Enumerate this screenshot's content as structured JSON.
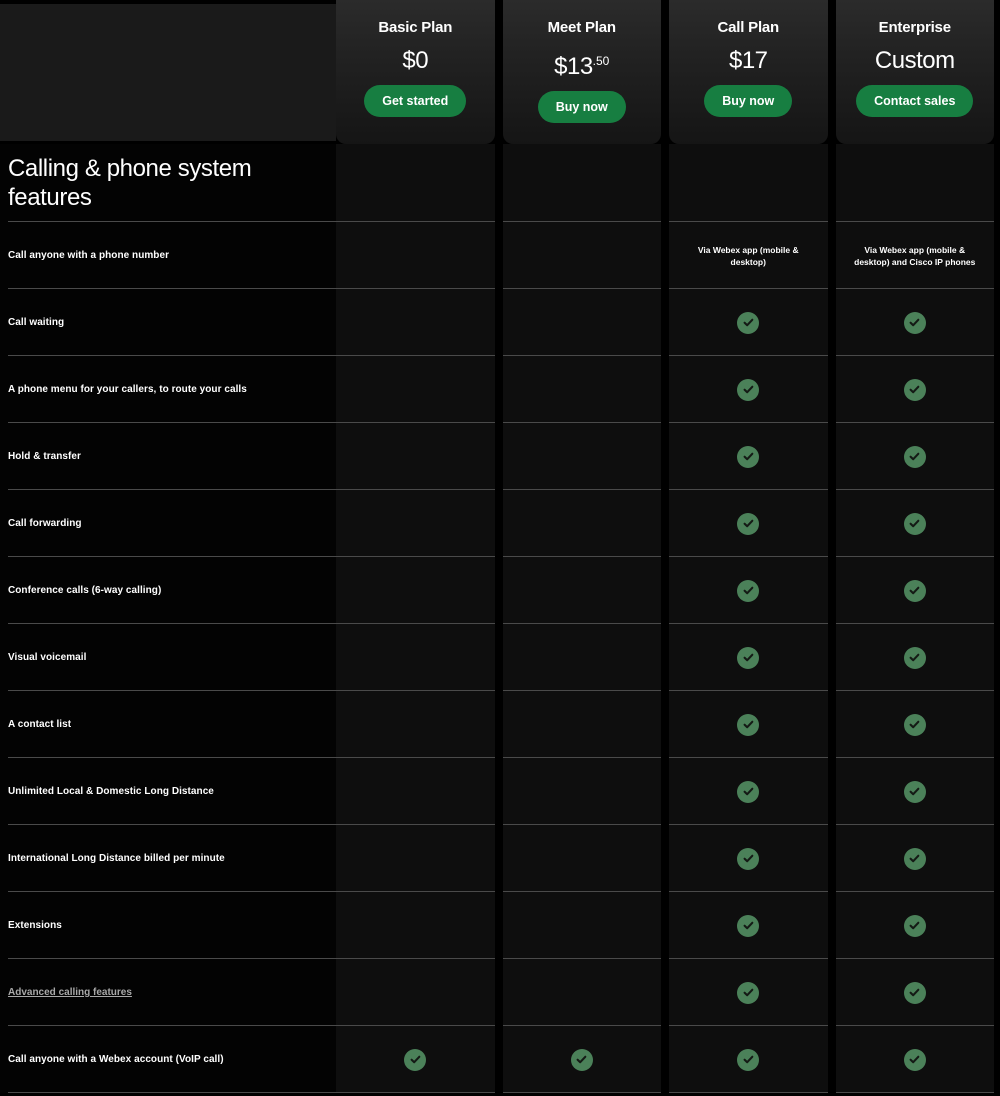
{
  "colors": {
    "page_background": "#000000",
    "card_background": "#1a1a1a",
    "column_background": "#0e0e0e",
    "cta_green": "#177e41",
    "check_green": "#4b8159",
    "divider": "#4a4a4a",
    "link_grey": "#a9a9a9"
  },
  "plans": [
    {
      "name": "Basic Plan",
      "price": "$0",
      "cents": "",
      "cta": "Get started"
    },
    {
      "name": "Meet Plan",
      "price": "$13",
      "cents": ".50",
      "cta": "Buy now"
    },
    {
      "name": "Call Plan",
      "price": "$17",
      "cents": "",
      "cta": "Buy now"
    },
    {
      "name": "Enterprise",
      "price": "Custom",
      "cents": "",
      "cta": "Contact sales"
    }
  ],
  "section": {
    "heading": "Calling & phone system features"
  },
  "features": [
    {
      "label": "Call anyone with a phone number",
      "is_link": false,
      "values": [
        "",
        "",
        "Via Webex app (mobile & desktop)",
        "Via Webex app (mobile & desktop) and Cisco IP phones"
      ]
    },
    {
      "label": "Call waiting",
      "is_link": false,
      "values": [
        "",
        "",
        "check",
        "check"
      ]
    },
    {
      "label": "A phone menu for your callers, to route your calls",
      "is_link": false,
      "values": [
        "",
        "",
        "check",
        "check"
      ]
    },
    {
      "label": "Hold & transfer",
      "is_link": false,
      "values": [
        "",
        "",
        "check",
        "check"
      ]
    },
    {
      "label": "Call forwarding",
      "is_link": false,
      "values": [
        "",
        "",
        "check",
        "check"
      ]
    },
    {
      "label": "Conference calls (6-way calling)",
      "is_link": false,
      "values": [
        "",
        "",
        "check",
        "check"
      ]
    },
    {
      "label": "Visual voicemail",
      "is_link": false,
      "values": [
        "",
        "",
        "check",
        "check"
      ]
    },
    {
      "label": "A contact list",
      "is_link": false,
      "values": [
        "",
        "",
        "check",
        "check"
      ]
    },
    {
      "label": "Unlimited Local & Domestic Long Distance",
      "is_link": false,
      "values": [
        "",
        "",
        "check",
        "check"
      ]
    },
    {
      "label": "International Long Distance billed per minute",
      "is_link": false,
      "values": [
        "",
        "",
        "check",
        "check"
      ]
    },
    {
      "label": "Extensions",
      "is_link": false,
      "values": [
        "",
        "",
        "check",
        "check"
      ]
    },
    {
      "label": "Advanced calling features",
      "is_link": true,
      "values": [
        "",
        "",
        "check",
        "check"
      ]
    },
    {
      "label": "Call anyone with a Webex account (VoIP call)",
      "is_link": false,
      "values": [
        "check",
        "check",
        "check",
        "check"
      ]
    }
  ],
  "icons": {
    "check": "check-circle-icon"
  }
}
